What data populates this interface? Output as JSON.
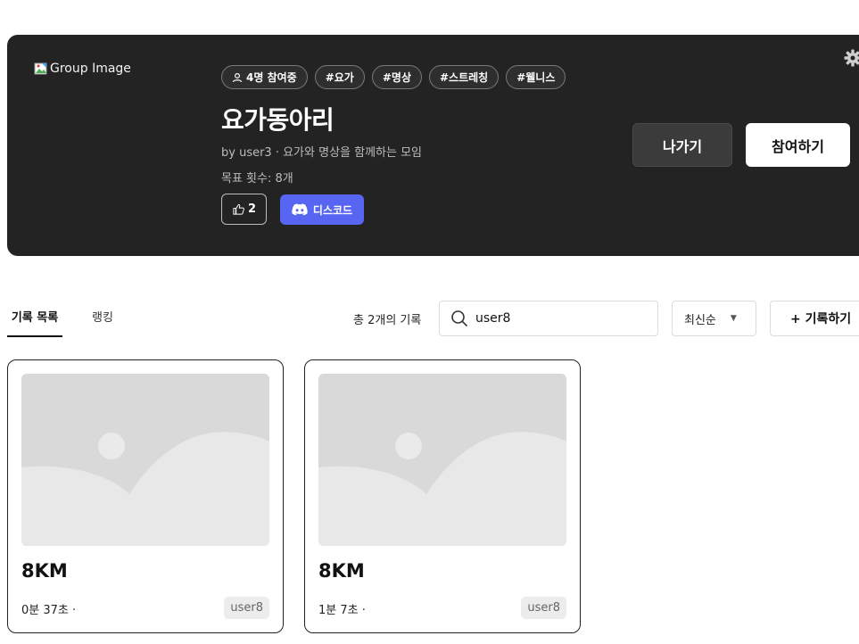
{
  "group": {
    "image_alt": "Group Image",
    "member_tag": "4명 참여중",
    "tags": [
      "#요가",
      "#명상",
      "#스트레칭",
      "#웰니스"
    ],
    "title": "요가동아리",
    "subtitle": "by user3 · 요가와 명상을 함께하는 모임",
    "goal": "목표 횟수: 8개",
    "likes": "2",
    "discord_label": "디스코드",
    "leave_label": "나가기",
    "join_label": "참여하기"
  },
  "toolbar": {
    "tabs": [
      "기록 목록",
      "랭킹"
    ],
    "record_count": "총 2개의 기록",
    "search_value": "user8",
    "sort_label": "최신순",
    "add_label": "+ 기록하기"
  },
  "records": [
    {
      "distance": "8KM",
      "time": "0분 37초 ·",
      "user": "user8"
    },
    {
      "distance": "8KM",
      "time": "1분 7초 ·",
      "user": "user8"
    }
  ],
  "colors": {
    "banner_bg": "#232323",
    "discord": "#5865f2",
    "placeholder": "#d9d9d9"
  },
  "icons": [
    "broken-image-icon",
    "gear-icon",
    "person-icon",
    "thumbs-up-icon",
    "discord-icon",
    "search-icon",
    "caret-down-icon",
    "image-placeholder-icon"
  ]
}
